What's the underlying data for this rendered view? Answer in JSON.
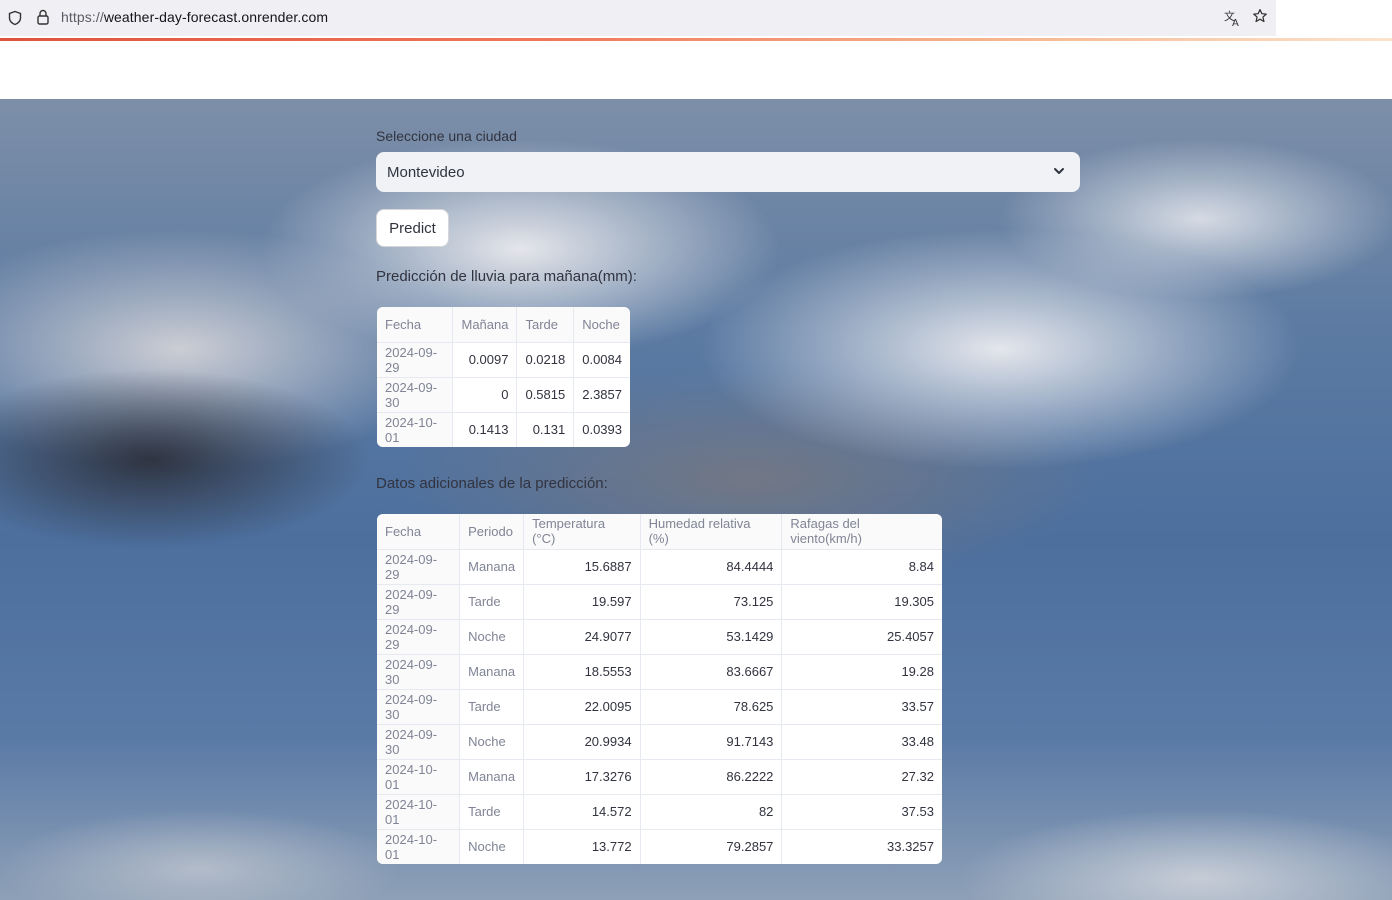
{
  "browser": {
    "url_scheme": "https://",
    "url_host": "weather-day-forecast.onrender.com"
  },
  "form": {
    "city_label": "Seleccione una ciudad",
    "city_value": "Montevideo",
    "predict_label": "Predict"
  },
  "rain": {
    "heading": "Predicción de lluvia para mañana(mm):",
    "columns": [
      "Fecha",
      "Mañana",
      "Tarde",
      "Noche"
    ],
    "rows": [
      [
        "2024-09-29",
        "0.0097",
        "0.0218",
        "0.0084"
      ],
      [
        "2024-09-30",
        "0",
        "0.5815",
        "2.3857"
      ],
      [
        "2024-10-01",
        "0.1413",
        "0.131",
        "0.0393"
      ]
    ]
  },
  "extra": {
    "heading": "Datos adicionales de la predicción:",
    "columns": [
      "Fecha",
      "Periodo",
      "Temperatura (°C)",
      "Humedad relativa (%)",
      "Rafagas del viento(km/h)"
    ],
    "rows": [
      [
        "2024-09-29",
        "Manana",
        "15.6887",
        "84.4444",
        "8.84"
      ],
      [
        "2024-09-29",
        "Tarde",
        "19.597",
        "73.125",
        "19.305"
      ],
      [
        "2024-09-29",
        "Noche",
        "24.9077",
        "53.1429",
        "25.4057"
      ],
      [
        "2024-09-30",
        "Manana",
        "18.5553",
        "83.6667",
        "19.28"
      ],
      [
        "2024-09-30",
        "Tarde",
        "22.0095",
        "78.625",
        "33.57"
      ],
      [
        "2024-09-30",
        "Noche",
        "20.9934",
        "91.7143",
        "33.48"
      ],
      [
        "2024-10-01",
        "Manana",
        "17.3276",
        "86.2222",
        "27.32"
      ],
      [
        "2024-10-01",
        "Tarde",
        "14.572",
        "82",
        "37.53"
      ],
      [
        "2024-10-01",
        "Noche",
        "13.772",
        "79.2857",
        "33.3257"
      ]
    ]
  }
}
